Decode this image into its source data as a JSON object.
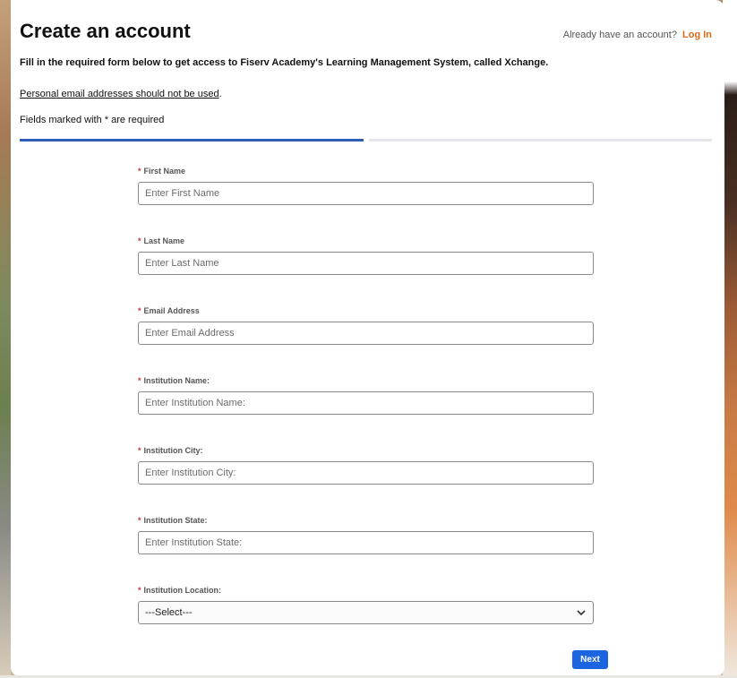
{
  "header": {
    "title": "Create an account",
    "login_prompt": "Already have an account?",
    "login_link": "Log In"
  },
  "intro": "Fill in the required form below to get access to Fiserv Academy's Learning Management System, called Xchange.",
  "warning": "Personal email addresses should not be used",
  "warning_suffix": ".",
  "required_note": "Fields marked with * are required",
  "progress": {
    "current_step": 1,
    "total_steps": 2
  },
  "required_marker": "*",
  "fields": [
    {
      "label": "First Name",
      "placeholder": "Enter First Name"
    },
    {
      "label": "Last Name",
      "placeholder": "Enter Last Name"
    },
    {
      "label": "Email Address",
      "placeholder": "Enter Email Address"
    },
    {
      "label": "Institution Name:",
      "placeholder": "Enter Institution Name:"
    },
    {
      "label": "Institution City:",
      "placeholder": "Enter Institution City:"
    },
    {
      "label": "Institution State:",
      "placeholder": "Enter Institution State:"
    }
  ],
  "location": {
    "label": "Institution Location:",
    "selected": "---Select---"
  },
  "next_label": "Next",
  "colors": {
    "accent": "#1b66e0",
    "link": "#e06a16",
    "progress": "#2e5cb8",
    "required": "#c23934"
  }
}
